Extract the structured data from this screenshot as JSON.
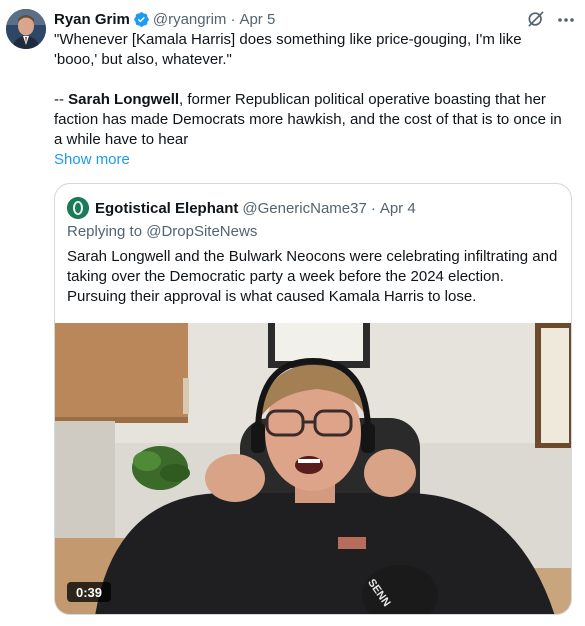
{
  "author": {
    "name": "Ryan Grim",
    "handle": "@ryangrim",
    "separator": "·",
    "date": "Apr 5"
  },
  "post": {
    "line1": "\"Whenever [Kamala Harris] does something like price-gouging, I'm like",
    "line2": "'booo,' but also, whatever.\"",
    "attribution_prefix": "-- ",
    "attribution_name": "Sarah Longwell",
    "attribution_rest": ", former Republican political operative boasting that her faction has made Democrats more hawkish, and the cost of that is to once in a while have to hear",
    "show_more": "Show more"
  },
  "quote": {
    "name": "Egotistical Elephant",
    "handle": "@GenericName37",
    "separator": "·",
    "date": "Apr 4",
    "replying_prefix": "Replying to ",
    "replying_to": "@DropSiteNews",
    "text": "Sarah Longwell and the Bulwark Neocons were celebrating infiltrating and taking over the Democratic party a week before the 2024 election. Pursuing their approval is what caused Kamala Harris to lose.",
    "video_duration": "0:39",
    "mic_text": "SENN"
  },
  "icons": {
    "verified": "verified-badge-icon",
    "grok": "grok-icon",
    "more": "more-icon"
  },
  "colors": {
    "link": "#1d9bf0",
    "secondary_text": "#536471",
    "border": "#cfd9de"
  }
}
